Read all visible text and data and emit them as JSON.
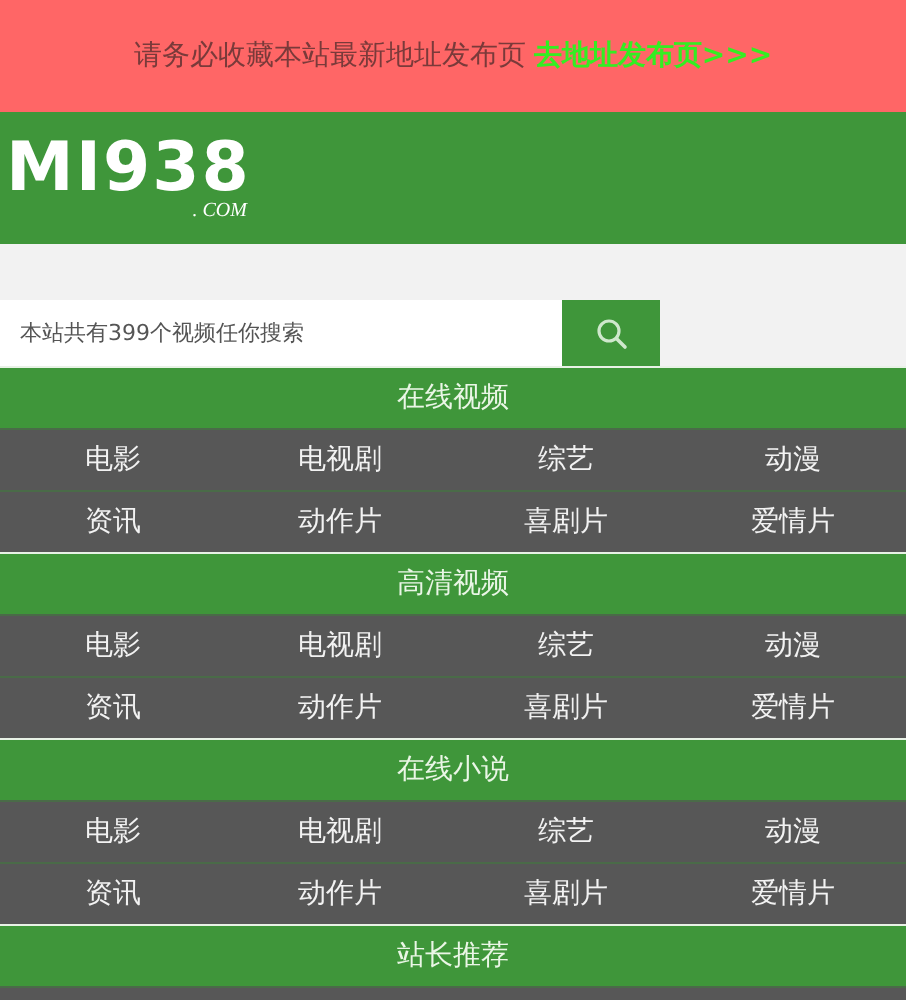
{
  "notice": {
    "text": "请务必收藏本站最新地址发布页",
    "link": "去地址发布页>>>"
  },
  "logo": {
    "name": "MI938",
    "suffix": ". COM"
  },
  "search": {
    "placeholder": "本站共有399个视频任你搜索"
  },
  "sections": [
    {
      "title": "在线视频",
      "rows": [
        [
          "电影",
          "电视剧",
          "综艺",
          "动漫"
        ],
        [
          "资讯",
          "动作片",
          "喜剧片",
          "爱情片"
        ]
      ]
    },
    {
      "title": "高清视频",
      "rows": [
        [
          "电影",
          "电视剧",
          "综艺",
          "动漫"
        ],
        [
          "资讯",
          "动作片",
          "喜剧片",
          "爱情片"
        ]
      ]
    },
    {
      "title": "在线小说",
      "rows": [
        [
          "电影",
          "电视剧",
          "综艺",
          "动漫"
        ],
        [
          "资讯",
          "动作片",
          "喜剧片",
          "爱情片"
        ]
      ]
    },
    {
      "title": "站长推荐",
      "rows": [
        []
      ]
    }
  ]
}
